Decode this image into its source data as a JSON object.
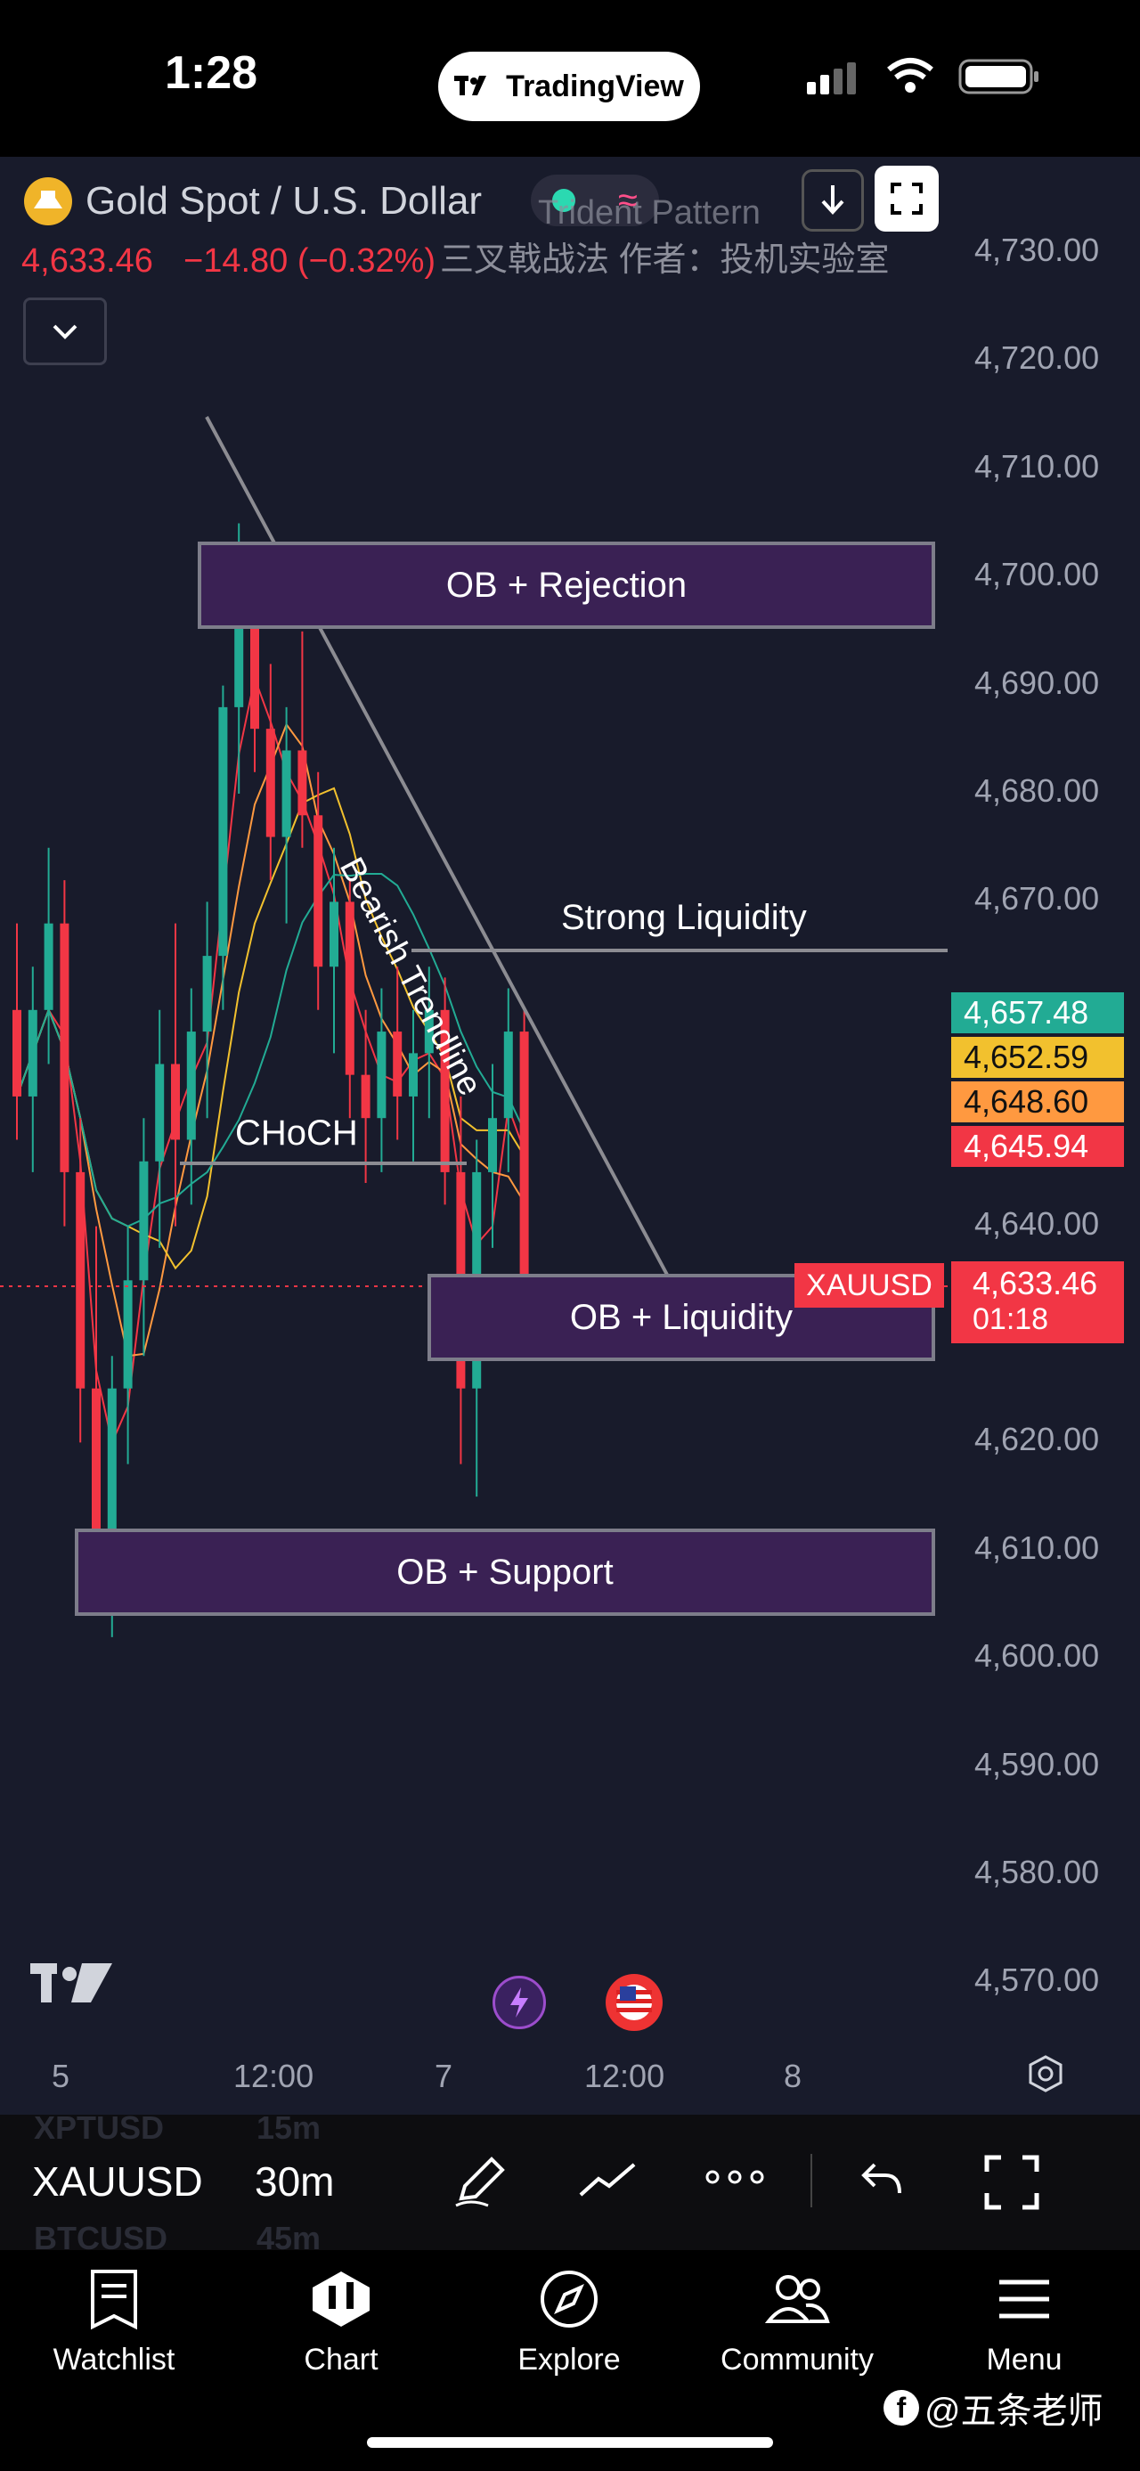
{
  "status_bar": {
    "time": "1:28",
    "app_pill": "TradingView"
  },
  "symbol": {
    "name": "Gold Spot / U.S. Dollar",
    "price": "4,633.46",
    "change": "−14.80 (−0.32%)"
  },
  "indicator": {
    "name": "Trident Pattern",
    "subtitle": "三叉戟战法 作者：投机实验室"
  },
  "price_axis": [
    "4,730.00",
    "4,720.00",
    "4,710.00",
    "4,700.00",
    "4,690.00",
    "4,680.00",
    "4,670.00",
    "4,640.00",
    "4,620.00",
    "4,610.00",
    "4,600.00",
    "4,590.00",
    "4,580.00",
    "4,570.00"
  ],
  "price_tags": [
    {
      "value": "4,657.48",
      "color": "#22ab94"
    },
    {
      "value": "4,652.59",
      "color": "#f2c12e"
    },
    {
      "value": "4,648.60",
      "color": "#ff9940"
    },
    {
      "value": "4,645.94",
      "color": "#f23645"
    }
  ],
  "current_price": {
    "symbol_tag": "XAUUSD",
    "value": "4,633.46",
    "countdown": "01:18",
    "color": "#f23645"
  },
  "annotations": {
    "ob_rejection": "OB + Rejection",
    "bearish_trendline": "Bearish Trendline",
    "strong_liquidity": "Strong Liquidity",
    "choch": "CHoCH",
    "ob_liquidity": "OB + Liquidity",
    "ob_support": "OB + Support"
  },
  "time_axis": [
    "5",
    "12:00",
    "7",
    "12:00",
    "8"
  ],
  "toolbar": {
    "symbol": "XAUUSD",
    "interval": "30m",
    "prev_symbol": "XPTUSD",
    "prev_interval": "15m",
    "next_symbol": "BTCUSD",
    "next_interval": "45m"
  },
  "nav": [
    {
      "label": "Watchlist",
      "icon": "watchlist-icon"
    },
    {
      "label": "Chart",
      "icon": "chart-icon"
    },
    {
      "label": "Explore",
      "icon": "compass-icon"
    },
    {
      "label": "Community",
      "icon": "community-icon"
    },
    {
      "label": "Menu",
      "icon": "menu-icon"
    }
  ],
  "watermark": "@五条老师",
  "chart_data": {
    "type": "candlestick",
    "ylim": [
      4565,
      4735
    ],
    "candles": [
      [
        4660,
        4668,
        4648,
        4652
      ],
      [
        4652,
        4664,
        4645,
        4660
      ],
      [
        4660,
        4675,
        4655,
        4668
      ],
      [
        4668,
        4672,
        4640,
        4645
      ],
      [
        4645,
        4650,
        4620,
        4625
      ],
      [
        4625,
        4640,
        4605,
        4610
      ],
      [
        4610,
        4628,
        4602,
        4625
      ],
      [
        4625,
        4640,
        4618,
        4635
      ],
      [
        4635,
        4650,
        4628,
        4646
      ],
      [
        4646,
        4660,
        4638,
        4655
      ],
      [
        4655,
        4668,
        4640,
        4648
      ],
      [
        4648,
        4662,
        4642,
        4658
      ],
      [
        4658,
        4670,
        4650,
        4665
      ],
      [
        4665,
        4690,
        4660,
        4688
      ],
      [
        4688,
        4705,
        4680,
        4698
      ],
      [
        4698,
        4702,
        4682,
        4686
      ],
      [
        4686,
        4692,
        4672,
        4676
      ],
      [
        4676,
        4688,
        4668,
        4684
      ],
      [
        4684,
        4695,
        4675,
        4678
      ],
      [
        4678,
        4682,
        4660,
        4664
      ],
      [
        4664,
        4675,
        4656,
        4670
      ],
      [
        4670,
        4672,
        4650,
        4654
      ],
      [
        4654,
        4660,
        4644,
        4650
      ],
      [
        4650,
        4662,
        4645,
        4658
      ],
      [
        4658,
        4664,
        4648,
        4652
      ],
      [
        4652,
        4660,
        4646,
        4656
      ],
      [
        4656,
        4664,
        4650,
        4660
      ],
      [
        4660,
        4663,
        4642,
        4645
      ],
      [
        4645,
        4652,
        4618,
        4625
      ],
      [
        4625,
        4648,
        4615,
        4645
      ],
      [
        4645,
        4655,
        4638,
        4650
      ],
      [
        4650,
        4662,
        4645,
        4658
      ],
      [
        4658,
        4660,
        4630,
        4633
      ]
    ]
  }
}
